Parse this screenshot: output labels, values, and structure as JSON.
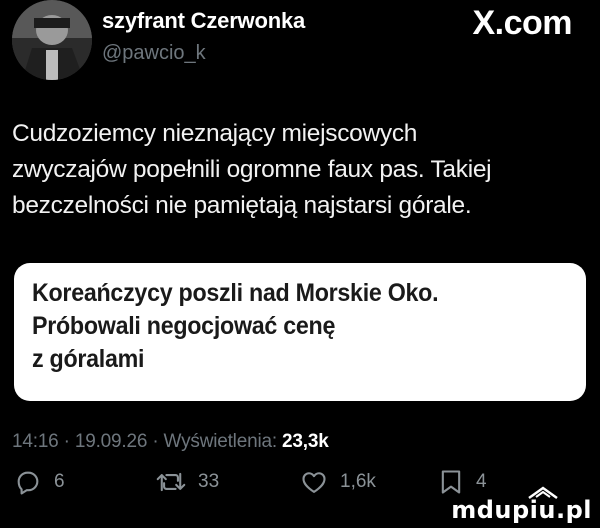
{
  "header": {
    "author_name": "szyfrant Czerwonka",
    "author_handle": "@pawcio_k",
    "brand": "X.com"
  },
  "tweet": {
    "text_lines": [
      "Cudzoziemcy nieznający miejscowych",
      "zwyczajów popełnili ogromne faux pas.  Takiej",
      "bezczelności nie pamiętają najstarsi górale."
    ]
  },
  "quote": {
    "lines": [
      "Koreańczycy poszli nad Morskie Oko.",
      "Próbowali negocjować cenę",
      "z góralami"
    ]
  },
  "meta": {
    "time": "14:16",
    "date": "19.09.26",
    "views_label": "Wyświetlenia:",
    "views_count": "23,3k"
  },
  "actions": {
    "replies": "6",
    "reposts": "33",
    "likes": "1,6k",
    "bookmarks": "4"
  },
  "watermark": "mdupiu.pl",
  "colors": {
    "background": "#000000",
    "text": "#ffffff",
    "muted": "#6e767d",
    "card": "#ffffff",
    "card_text": "#1a1a1a"
  }
}
